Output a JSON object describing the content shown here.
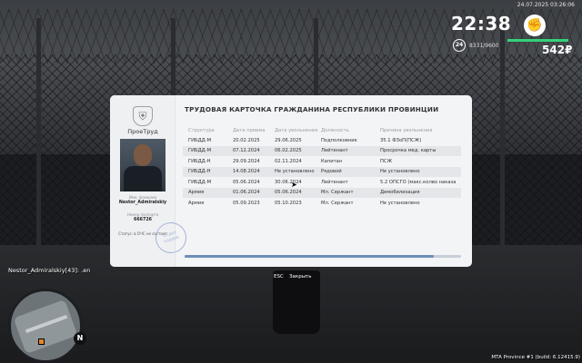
{
  "hud": {
    "datetime": "24.07.2025 03:26:06",
    "time": "22:38",
    "fist_icon": "✊",
    "level": "24",
    "xp": "8331/9600",
    "health_fraction": 0.96,
    "money": "542₽",
    "accent_color": "#33d17a"
  },
  "card": {
    "org_name": "ПроеТруд",
    "emblem_icon": "⛨",
    "title": "ТРУДОВАЯ КАРТОЧКА ГРАЖДАНИНА РЕСПУБЛИКИ ПРОВИНЦИИ",
    "name_label": "Имя, фамилия",
    "name_value": "Nestor_Admiralskiy",
    "id_label": "Номер паспорта",
    "id_value": "666726",
    "stamp_text": "Отдел кадров",
    "status_text": "Статус: в ОЧС не состоит",
    "headers": [
      "Структура",
      "Дата приема",
      "Дата увольнения",
      "Должность",
      "Причина увольнения"
    ],
    "rows": [
      [
        "ГИБДД-М",
        "20.02.2025",
        "29.06.2025",
        "Подполковник",
        "35.1 ФЗоП(ПСЖ)"
      ],
      [
        "ГИБДД-М",
        "07.12.2024",
        "06.02.2025",
        "Лейтенант",
        "Просрочка мед. карты"
      ],
      [
        "ГИБДД-Н",
        "29.09.2024",
        "02.11.2024",
        "Капитан",
        "ПСЖ"
      ],
      [
        "ГИБДД-Н",
        "14.08.2024",
        "Не установлено",
        "Рядовой",
        "Не установлено"
      ],
      [
        "ГИБДД-М",
        "05.06.2024",
        "30.06.2024",
        "Лейтенант",
        "5.2 ОПСГО (макс.колво наказа"
      ],
      [
        "Армия",
        "01.06.2024",
        "05.06.2024",
        "Мл. Сержант",
        "Демобилизация"
      ],
      [
        "Армия",
        "05.09.2023",
        "05.10.2023",
        "Мл. Сержант",
        "Не установлено"
      ]
    ],
    "scroll_fraction": 0.9
  },
  "close_hint": {
    "key": "ESC",
    "label": "Закрыть"
  },
  "player_tag": "Nestor_Admiralskiy[43]: .en",
  "minimap": {
    "north": "N"
  },
  "build": "MTA Province #1 (build: 6.12415.9)"
}
